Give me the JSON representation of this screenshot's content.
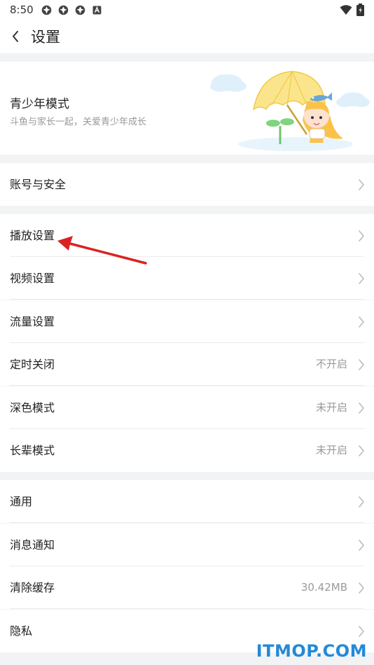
{
  "status_bar": {
    "time": "8:50",
    "icons": [
      "settings-gear-icon",
      "settings-gear-icon",
      "settings-gear-icon",
      "a-badge-icon"
    ],
    "right_icons": [
      "wifi-icon",
      "battery-icon"
    ]
  },
  "header": {
    "title": "设置",
    "back_icon": "chevron-left-icon"
  },
  "youth_mode": {
    "title": "青少年模式",
    "subtitle": "斗鱼与家长一起，关爱青少年成长",
    "illustration": "girl-with-umbrella"
  },
  "groups": [
    {
      "rows": [
        {
          "label": "账号与安全",
          "value": ""
        }
      ]
    },
    {
      "rows": [
        {
          "label": "播放设置",
          "value": ""
        },
        {
          "label": "视频设置",
          "value": ""
        },
        {
          "label": "流量设置",
          "value": ""
        },
        {
          "label": "定时关闭",
          "value": "不开启"
        },
        {
          "label": "深色模式",
          "value": "未开启"
        },
        {
          "label": "长辈模式",
          "value": "未开启"
        }
      ]
    },
    {
      "rows": [
        {
          "label": "通用",
          "value": ""
        },
        {
          "label": "消息通知",
          "value": ""
        },
        {
          "label": "清除缓存",
          "value": "30.42MB"
        },
        {
          "label": "隐私",
          "value": ""
        }
      ]
    }
  ],
  "annotation": {
    "type": "red-arrow",
    "target": "播放设置",
    "color": "#d92323"
  },
  "watermark": "ITMOP.COM",
  "colors": {
    "background": "#f2f3f5",
    "card": "#ffffff",
    "text_primary": "#222222",
    "text_secondary": "#999999",
    "watermark": "#2489d8"
  }
}
